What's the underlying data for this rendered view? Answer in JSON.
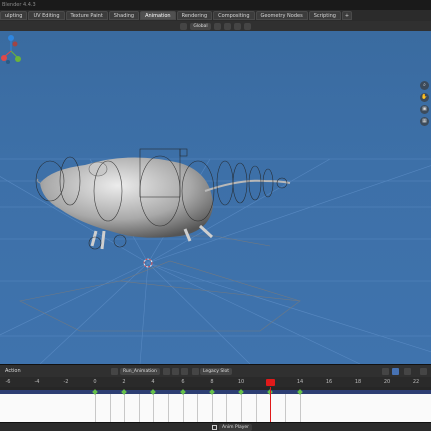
{
  "window": {
    "title": "Blender 4.4.3"
  },
  "workspace_tabs": [
    "ulpting",
    "UV Editing",
    "Texture Paint",
    "Shading",
    "Animation",
    "Rendering",
    "Compositing",
    "Geometry Nodes",
    "Scripting",
    "+"
  ],
  "active_tab_index": 4,
  "viewport_header": {
    "orientation": "Global"
  },
  "timeline": {
    "editor_label": "Action",
    "action_name": "Run_Animation",
    "slot_name": "Legacy Slot",
    "ruler_ticks": [
      "-6",
      "-4",
      "-2",
      "0",
      "2",
      "4",
      "6",
      "8",
      "10",
      "12",
      "14",
      "16",
      "18",
      "20",
      "22"
    ],
    "current_frame": "12",
    "keyframes": [
      "0",
      "2",
      "4",
      "6",
      "8",
      "10",
      "12",
      "14"
    ]
  },
  "colors": {
    "accent": "#4772b3",
    "playhead": "#e01a1a",
    "keyframe": "#66c04a",
    "viewport": "#3d70a8"
  },
  "status_bar": {
    "message": "Anim Player",
    "icon": "mouse-icon"
  }
}
